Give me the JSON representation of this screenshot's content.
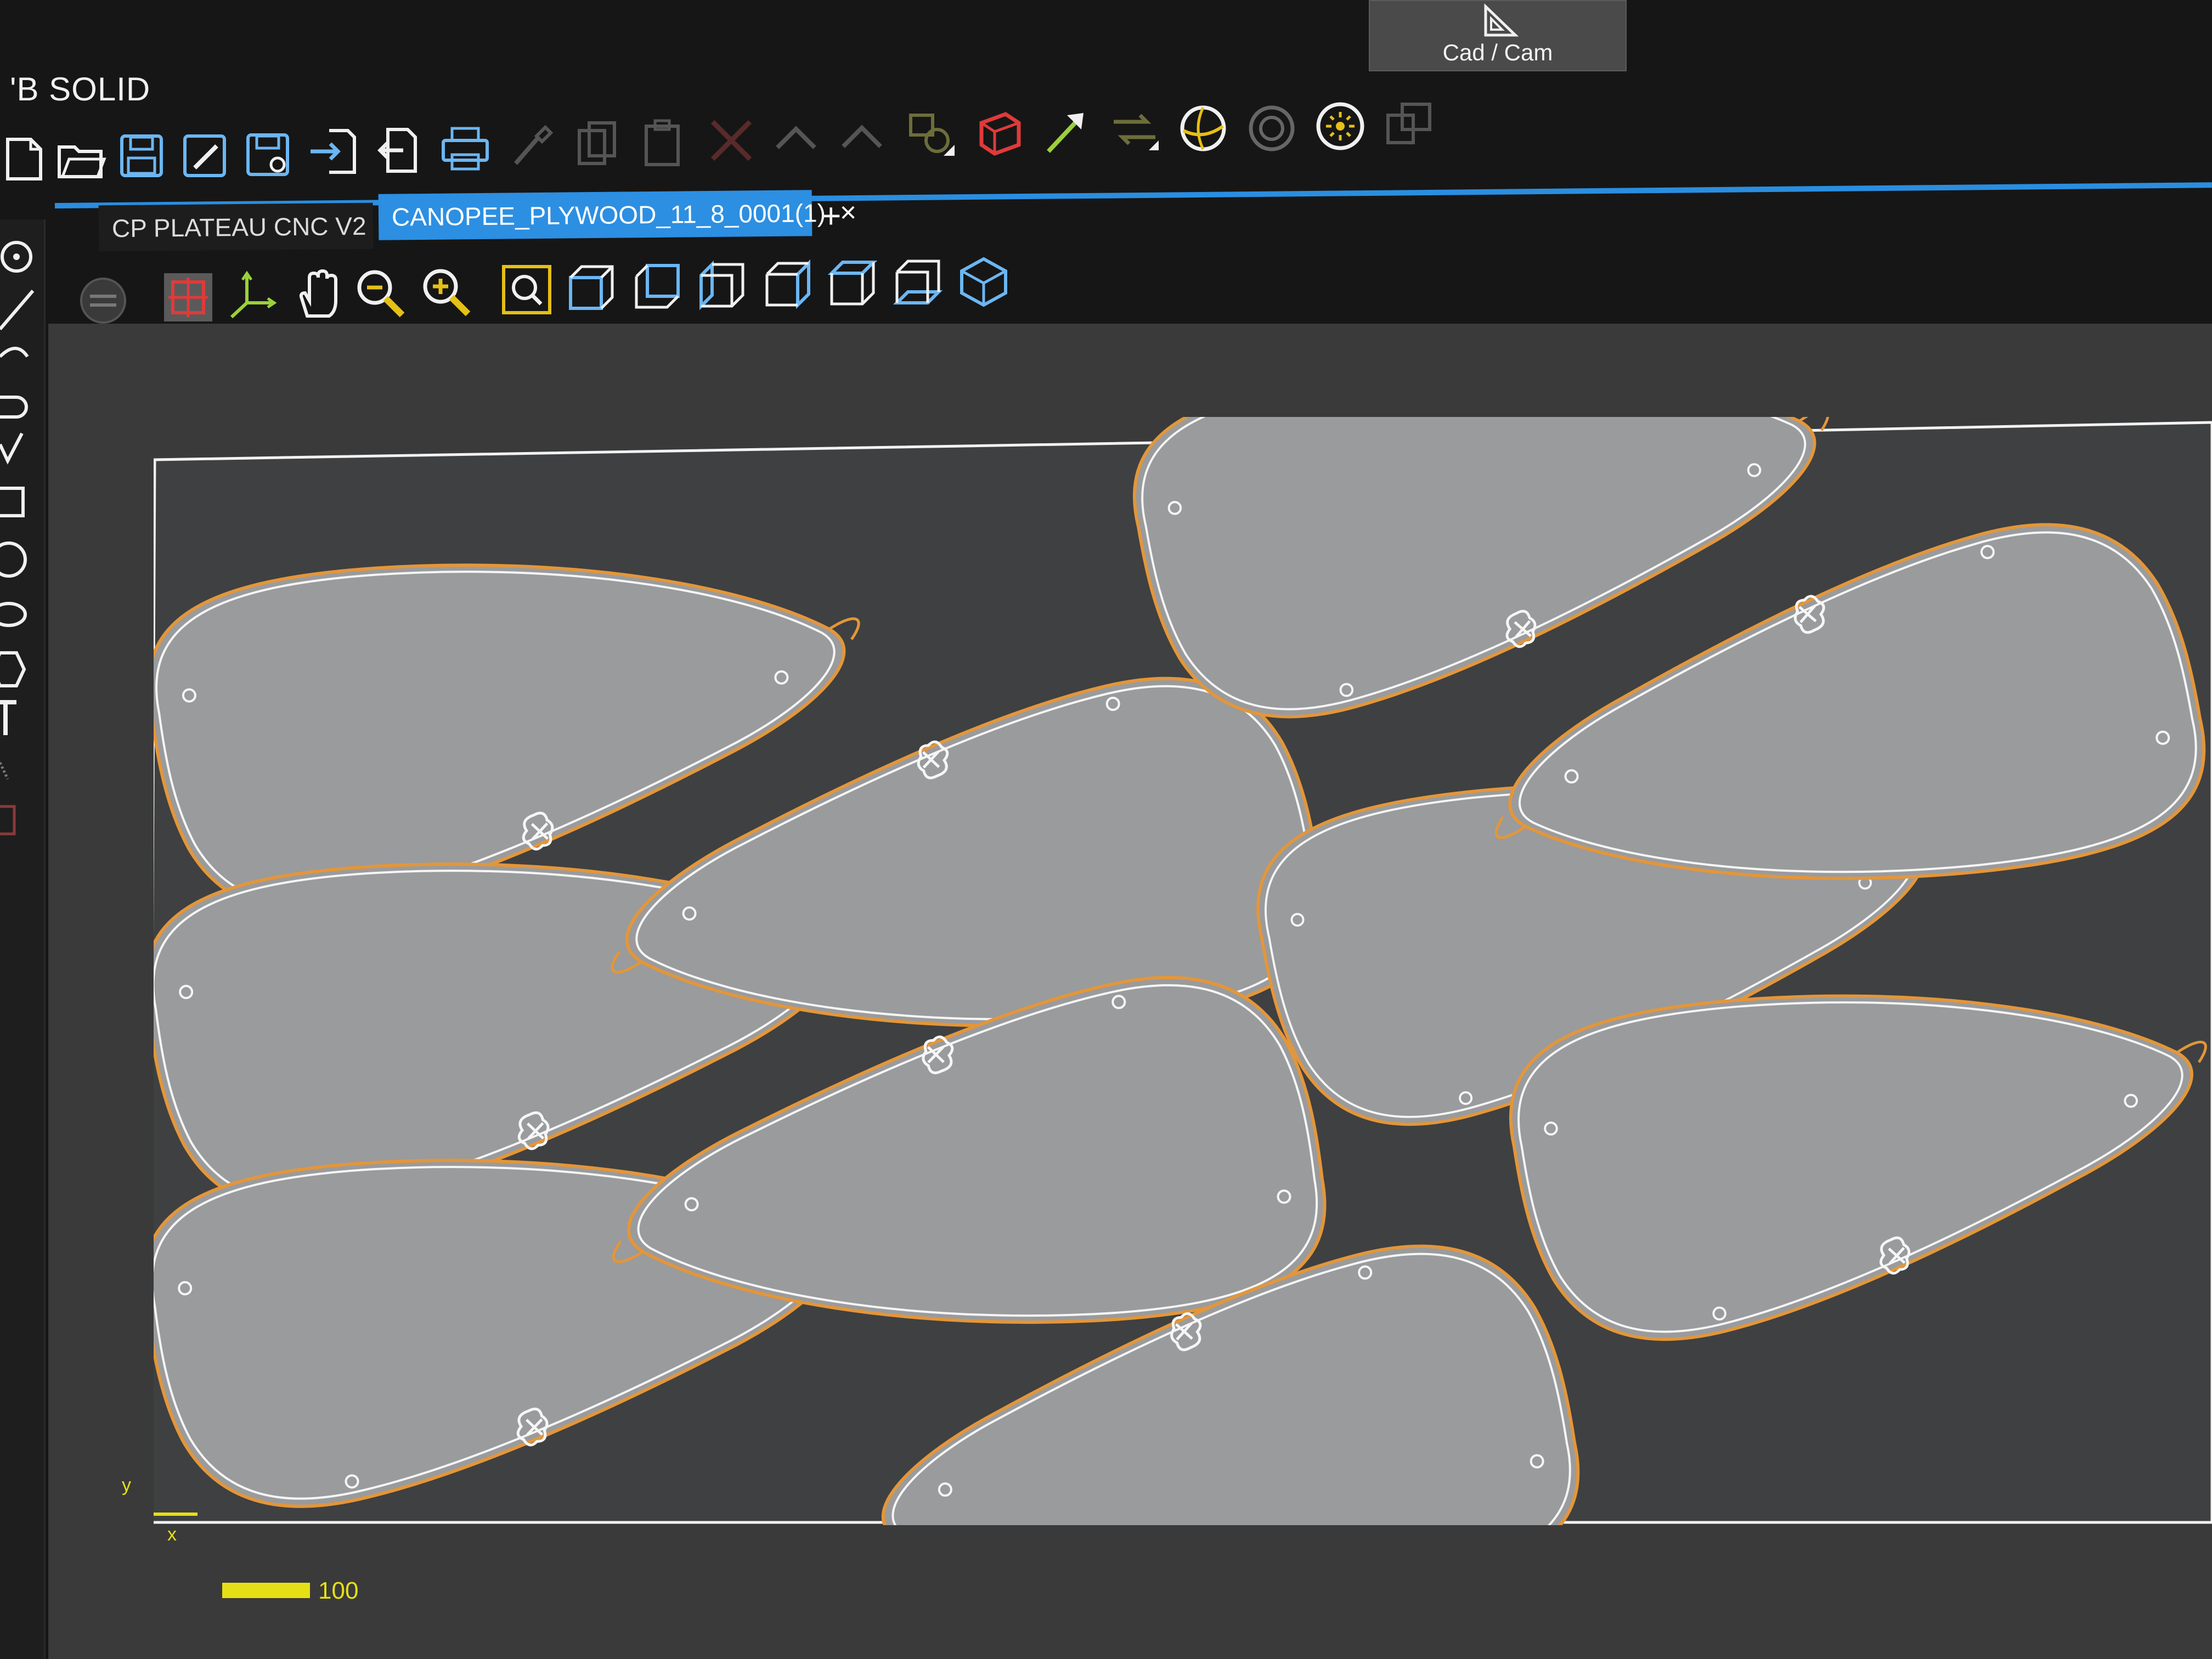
{
  "app": {
    "title": "'B SOLID"
  },
  "header": {
    "cadcam_label": "Cad / Cam"
  },
  "toolbar": {
    "items": [
      {
        "name": "new-file-icon"
      },
      {
        "name": "open-folder-icon"
      },
      {
        "name": "save-icon"
      },
      {
        "name": "save-as-icon"
      },
      {
        "name": "save-all-icon"
      },
      {
        "name": "import-icon"
      },
      {
        "name": "export-icon"
      },
      {
        "name": "print-icon"
      },
      {
        "name": "brush-icon"
      },
      {
        "name": "copy-icon"
      },
      {
        "name": "paste-icon"
      },
      {
        "name": "delete-icon"
      },
      {
        "name": "undo-icon"
      },
      {
        "name": "redo-icon"
      },
      {
        "name": "shape-link-icon"
      },
      {
        "name": "cube-red-icon"
      },
      {
        "name": "arrow-green-icon"
      },
      {
        "name": "swap-icon"
      },
      {
        "name": "sphere-icon"
      },
      {
        "name": "target-icon"
      },
      {
        "name": "sun-icon"
      },
      {
        "name": "frame-icon"
      }
    ]
  },
  "tabs": [
    {
      "label": "CP PLATEAU CNC V2",
      "close": "×",
      "active": false
    },
    {
      "label": "CANOPEE_PLYWOOD_11_8_0001(1)",
      "close": "×",
      "active": true
    }
  ],
  "new_tab": "+",
  "view_toolbar": {
    "items": [
      {
        "name": "view-settings-icon"
      },
      {
        "name": "select-target-icon"
      },
      {
        "name": "axes-icon"
      },
      {
        "name": "pan-hand-icon"
      },
      {
        "name": "zoom-out-icon"
      },
      {
        "name": "zoom-in-icon"
      },
      {
        "name": "zoom-window-icon"
      },
      {
        "name": "view-front-icon"
      },
      {
        "name": "view-back-icon"
      },
      {
        "name": "view-left-icon"
      },
      {
        "name": "view-right-icon"
      },
      {
        "name": "view-top-icon"
      },
      {
        "name": "view-bottom-icon"
      },
      {
        "name": "view-iso-icon"
      }
    ]
  },
  "canvas": {
    "axis_y": "y",
    "axis_x": "x",
    "scale_value": "100",
    "colors": {
      "outline_outer": "#e3963a",
      "outline_inner": "#ffffff",
      "part_fill": "#9a9b9d",
      "sheet_fill": "#3f4041",
      "accent": "#2c8fe2",
      "scale": "#e5e015"
    }
  }
}
